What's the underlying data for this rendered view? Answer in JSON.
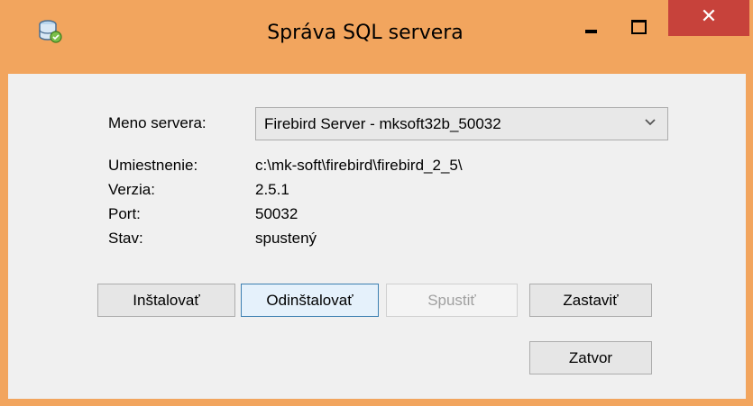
{
  "window": {
    "title": "Správa SQL servera",
    "close_label": "✕",
    "colors": {
      "frame": "#f2a55e",
      "close": "#c7423b",
      "client": "#f0f0f0",
      "focus_border": "#3c7fb1"
    }
  },
  "server": {
    "name_label": "Meno servera:",
    "selected": "Firebird Server - mksoft32b_50032"
  },
  "info": {
    "location_label": "Umiestnenie:",
    "location_value": "c:\\mk-soft\\firebird\\firebird_2_5\\",
    "version_label": "Verzia:",
    "version_value": "2.5.1",
    "port_label": "Port:",
    "port_value": "50032",
    "status_label": "Stav:",
    "status_value": "spustený"
  },
  "buttons": {
    "install": "Inštalovať",
    "uninstall": "Odinštalovať",
    "start": "Spustiť",
    "stop": "Zastaviť",
    "close": "Zatvor"
  },
  "icons": {
    "app": "database-app-icon",
    "minimize": "minimize-icon",
    "maximize": "maximize-icon",
    "close": "close-icon",
    "dropdown": "chevron-down-icon"
  }
}
